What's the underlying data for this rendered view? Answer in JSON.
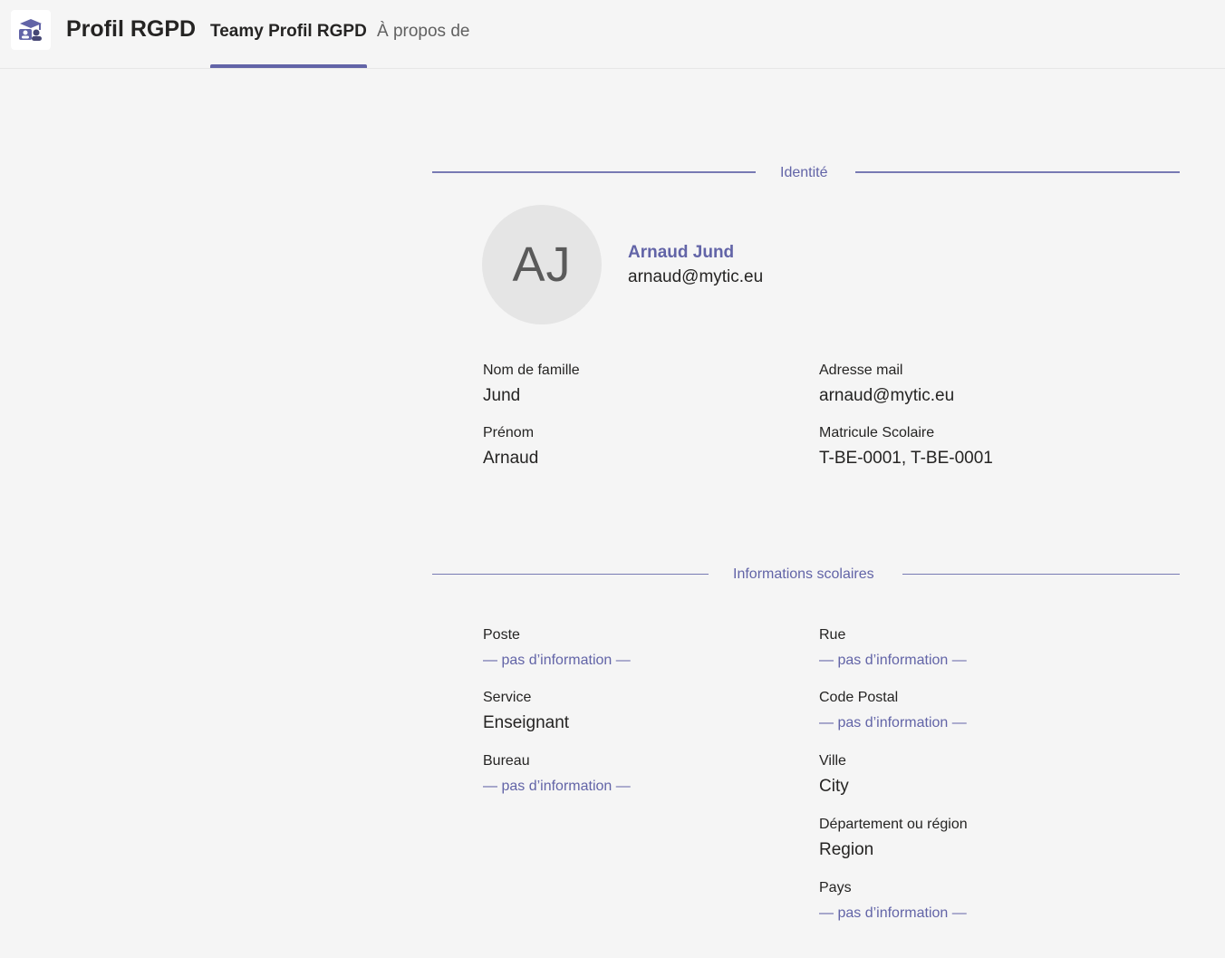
{
  "app": {
    "title": "Profil RGPD",
    "icon": "graduation-cap-users-icon",
    "accent_color": "#6264a7"
  },
  "tabs": [
    {
      "label": "Teamy Profil RGPD",
      "active": true
    },
    {
      "label": "À propos de",
      "active": false
    }
  ],
  "identity": {
    "section_title": "Identité",
    "avatar_initials": "AJ",
    "display_name": "Arnaud Jund",
    "email": "arnaud@mytic.eu",
    "fields": {
      "last_name": {
        "label": "Nom de famille",
        "value": "Jund"
      },
      "first_name": {
        "label": "Prénom",
        "value": "Arnaud"
      },
      "mail": {
        "label": "Adresse mail",
        "value": "arnaud@mytic.eu"
      },
      "matricule": {
        "label": "Matricule Scolaire",
        "value": "T-BE-0001, T-BE-0001"
      }
    }
  },
  "school": {
    "section_title": "Informations scolaires",
    "fields": {
      "poste": {
        "label": "Poste",
        "value": "— pas d’information —"
      },
      "service": {
        "label": "Service",
        "value": "Enseignant"
      },
      "bureau": {
        "label": "Bureau",
        "value": "— pas d’information —"
      },
      "rue": {
        "label": "Rue",
        "value": "— pas d’information —"
      },
      "code_postal": {
        "label": "Code Postal",
        "value": "— pas d’information —"
      },
      "ville": {
        "label": "Ville",
        "value": "City"
      },
      "departement": {
        "label": "Département ou région",
        "value": "Region"
      },
      "pays": {
        "label": "Pays",
        "value": "— pas d’information —"
      }
    }
  }
}
